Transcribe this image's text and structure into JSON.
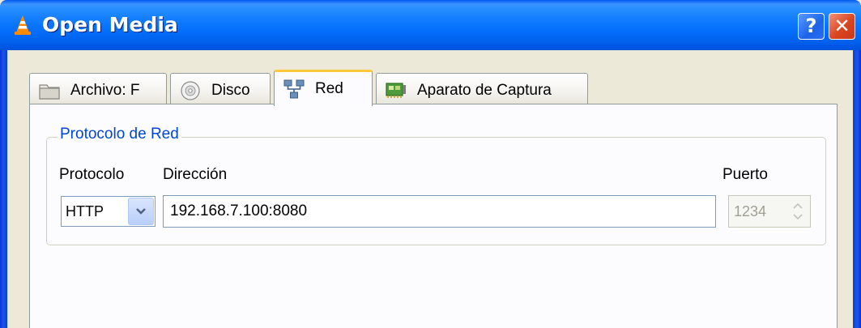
{
  "window": {
    "title": "Open Media",
    "help_label": "?",
    "close_label": "✕"
  },
  "tabs": [
    {
      "label": "Archivo: F",
      "icon": "folder-icon",
      "active": false
    },
    {
      "label": "Disco",
      "icon": "disc-icon",
      "active": false
    },
    {
      "label": "Red",
      "icon": "network-icon",
      "active": true
    },
    {
      "label": "Aparato de Captura",
      "icon": "capture-card-icon",
      "active": false
    }
  ],
  "network": {
    "group_title": "Protocolo de Red",
    "protocol_label": "Protocolo",
    "protocol_value": "HTTP",
    "address_label": "Dirección",
    "address_value": "192.168.7.100:8080",
    "port_label": "Puerto",
    "port_value": "1234"
  },
  "colors": {
    "titlebar": "#0055e5",
    "active_tab_accent": "#ffc83c",
    "group_title": "#0046d5",
    "close_button": "#d9451f"
  }
}
